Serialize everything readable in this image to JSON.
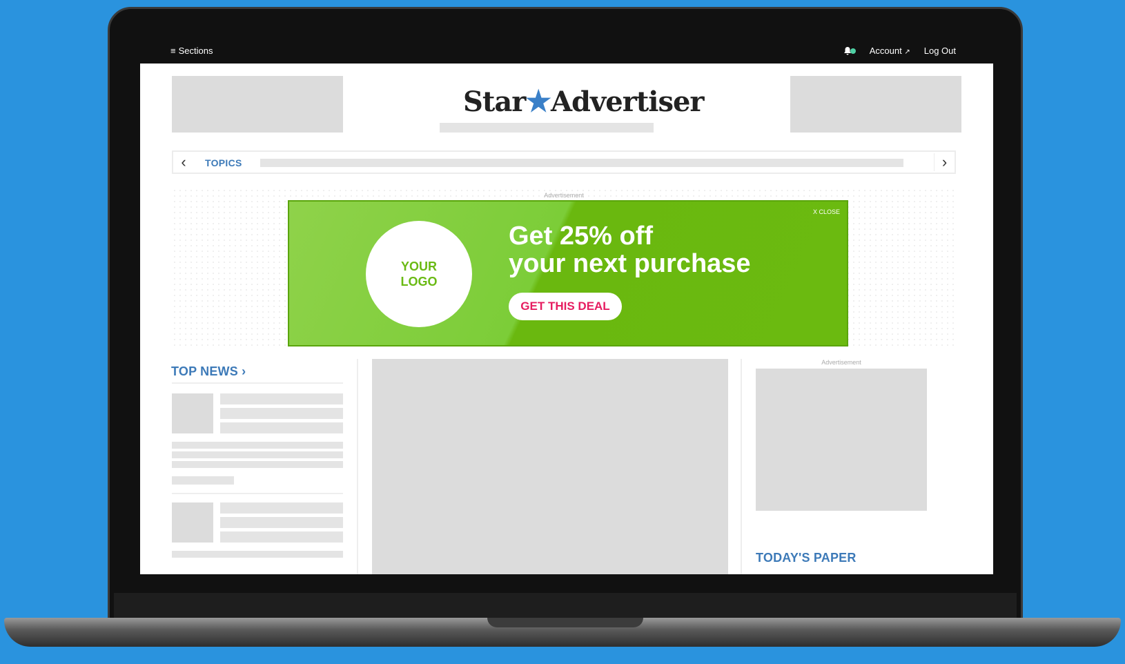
{
  "topbar": {
    "sections_label": "Sections",
    "account_label": "Account",
    "logout_label": "Log Out"
  },
  "masthead": {
    "brand_left": "Star",
    "brand_right": "Advertiser"
  },
  "topics": {
    "label": "TOPICS"
  },
  "advert": {
    "label": "Advertisement",
    "close": "X CLOSE",
    "logo_line1": "YOUR",
    "logo_line2": "LOGO",
    "headline_line1": "Get 25% off",
    "headline_line2": "your next purchase",
    "cta": "GET THIS DEAL",
    "accent_color": "#6bba10",
    "cta_color": "#e61c60"
  },
  "sidebar_ad": {
    "label": "Advertisement"
  },
  "sections": {
    "top_news": "TOP NEWS",
    "todays_paper": "TODAY'S PAPER"
  },
  "colors": {
    "background": "#2a93de",
    "section_title": "#3d7ab8"
  }
}
